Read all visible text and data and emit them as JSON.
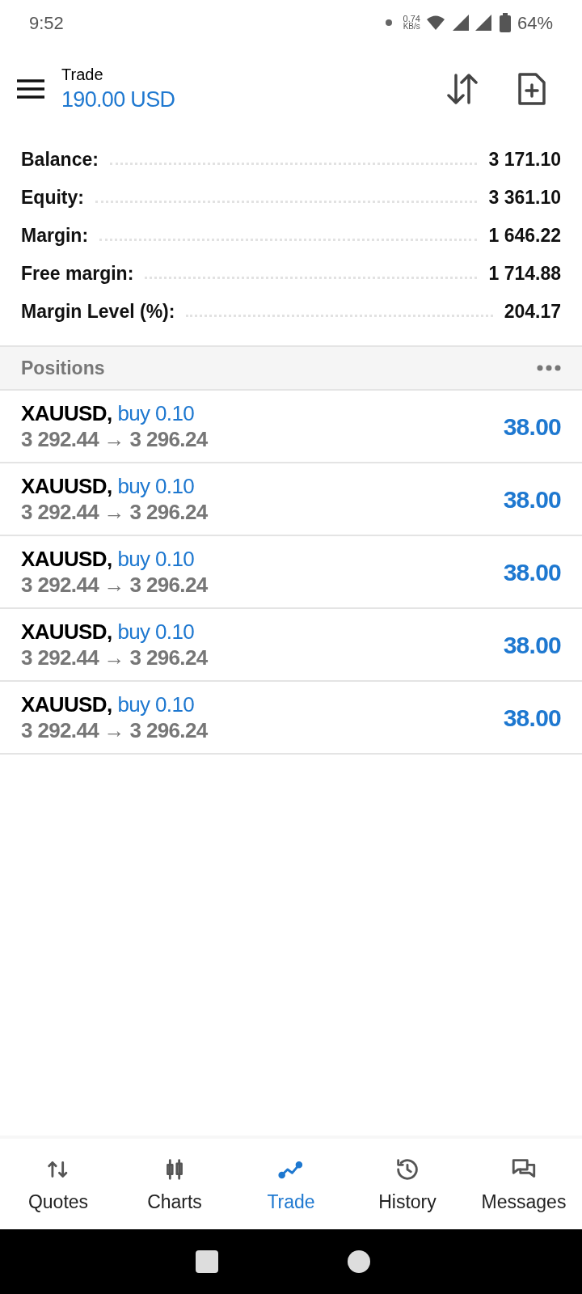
{
  "status_bar": {
    "time": "9:52",
    "net_speed_value": "0.74",
    "net_speed_unit": "KB/s",
    "battery": "64%"
  },
  "header": {
    "title": "Trade",
    "subtitle": "190.00 USD"
  },
  "summary": [
    {
      "label": "Balance:",
      "value": "3 171.10"
    },
    {
      "label": "Equity:",
      "value": "3 361.10"
    },
    {
      "label": "Margin:",
      "value": "1 646.22"
    },
    {
      "label": "Free margin:",
      "value": "1 714.88"
    },
    {
      "label": "Margin Level (%):",
      "value": "204.17"
    }
  ],
  "positions_header": {
    "title": "Positions"
  },
  "positions": [
    {
      "symbol": "XAUUSD,",
      "order": "buy 0.10",
      "prices": "3 292.44 → 3 296.24",
      "profit": "38.00"
    },
    {
      "symbol": "XAUUSD,",
      "order": "buy 0.10",
      "prices": "3 292.44 → 3 296.24",
      "profit": "38.00"
    },
    {
      "symbol": "XAUUSD,",
      "order": "buy 0.10",
      "prices": "3 292.44 → 3 296.24",
      "profit": "38.00"
    },
    {
      "symbol": "XAUUSD,",
      "order": "buy 0.10",
      "prices": "3 292.44 → 3 296.24",
      "profit": "38.00"
    },
    {
      "symbol": "XAUUSD,",
      "order": "buy 0.10",
      "prices": "3 292.44 → 3 296.24",
      "profit": "38.00"
    }
  ],
  "bottom_nav": [
    {
      "kind": "quotes",
      "label": "Quotes",
      "selected": false
    },
    {
      "kind": "charts",
      "label": "Charts",
      "selected": false
    },
    {
      "kind": "trade",
      "label": "Trade",
      "selected": true
    },
    {
      "kind": "history",
      "label": "History",
      "selected": false
    },
    {
      "kind": "messages",
      "label": "Messages",
      "selected": false
    }
  ]
}
